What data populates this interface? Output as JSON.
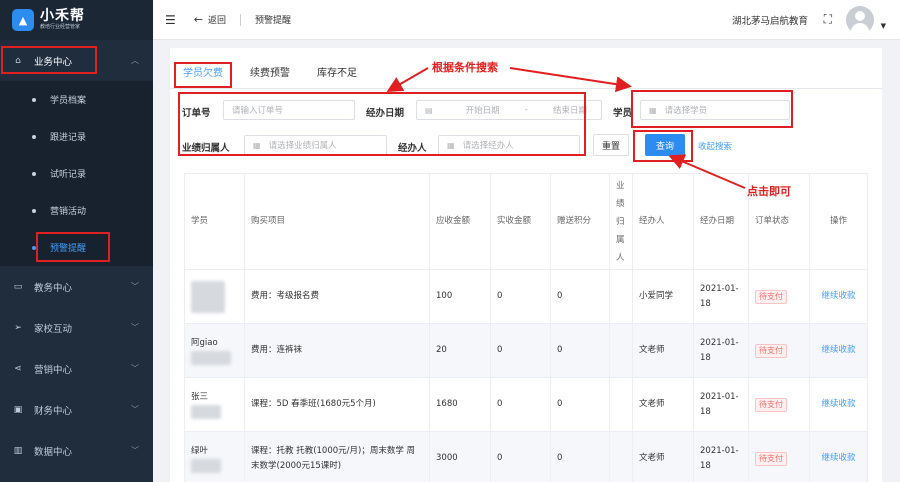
{
  "brand": {
    "logo_glyph": "▲",
    "name": "小禾帮",
    "slogan": "教培行业经营管家"
  },
  "sidebar": {
    "groups": [
      {
        "label": "业务中心",
        "icon": "home-icon",
        "expanded": true,
        "items": [
          {
            "label": "学员档案"
          },
          {
            "label": "跟进记录"
          },
          {
            "label": "试听记录"
          },
          {
            "label": "营销活动"
          },
          {
            "label": "预警提醒",
            "active": true
          }
        ]
      },
      {
        "label": "教务中心",
        "icon": "book-icon"
      },
      {
        "label": "家校互动",
        "icon": "send-icon"
      },
      {
        "label": "营销中心",
        "icon": "share-icon"
      },
      {
        "label": "财务中心",
        "icon": "wallet-icon"
      },
      {
        "label": "数据中心",
        "icon": "chart-icon"
      }
    ]
  },
  "header": {
    "back_label": "返回",
    "breadcrumb": "预警提醒",
    "org_name": "湖北茅马启航教育"
  },
  "tabs": [
    {
      "label": "学员欠费",
      "active": true
    },
    {
      "label": "续费预警"
    },
    {
      "label": "库存不足"
    }
  ],
  "filters": {
    "order_no": {
      "label": "订单号",
      "placeholder": "请输入订单号"
    },
    "date": {
      "label": "经办日期",
      "start_placeholder": "开始日期",
      "separator": "-",
      "end_placeholder": "结束日期"
    },
    "student": {
      "label": "学员",
      "placeholder": "请选择学员"
    },
    "owner": {
      "label": "业绩归属人",
      "placeholder": "请选择业绩归属人"
    },
    "handler": {
      "label": "经办人",
      "placeholder": "请选择经办人"
    },
    "reset_label": "重置",
    "query_label": "查询",
    "collapse_label": "收起搜索"
  },
  "table": {
    "columns": [
      "学员",
      "购买项目",
      "应收金额",
      "实收金额",
      "赠送积分",
      "业绩归属人",
      "经办人",
      "经办日期",
      "订单状态",
      "操作"
    ],
    "rows": [
      {
        "student": "",
        "item": "费用：考级报名费",
        "due": "100",
        "paid": "0",
        "points": "0",
        "owner": "",
        "handler": "小爱同学",
        "date": "2021-01-18",
        "status": "待支付",
        "action": "继续收款"
      },
      {
        "student": "阿giao",
        "item": "费用：连裤袜",
        "due": "20",
        "paid": "0",
        "points": "0",
        "owner": "",
        "handler": "文老师",
        "date": "2021-01-18",
        "status": "待支付",
        "action": "继续收款"
      },
      {
        "student": "张三",
        "item": "课程：5D 春季班(1680元5个月)",
        "due": "1680",
        "paid": "0",
        "points": "0",
        "owner": "",
        "handler": "文老师",
        "date": "2021-01-18",
        "status": "待支付",
        "action": "继续收款"
      },
      {
        "student": "绿叶",
        "item": "课程：托教 托教(1000元/月)；周末数学 周末数学(2000元15课时)",
        "due": "3000",
        "paid": "0",
        "points": "0",
        "owner": "",
        "handler": "文老师",
        "date": "2021-01-18",
        "status": "待支付",
        "action": "继续收款"
      }
    ]
  },
  "annotations": {
    "search_hint": "根据条件搜索",
    "click_hint": "点击即可",
    "color": "#e02020"
  }
}
